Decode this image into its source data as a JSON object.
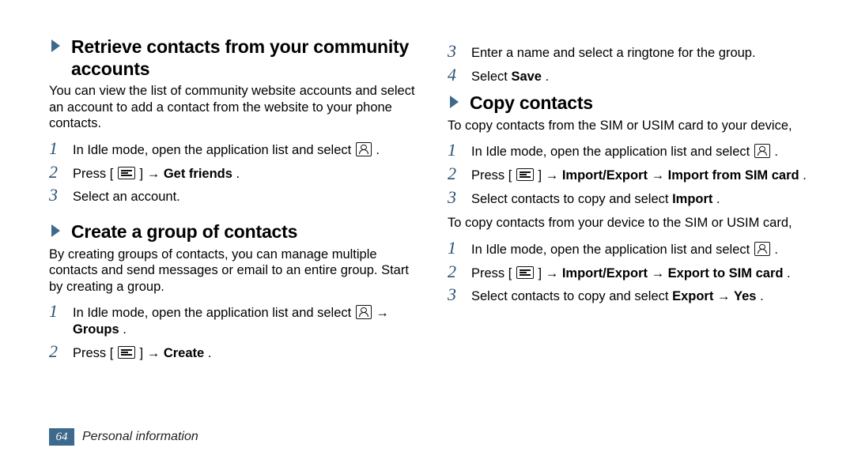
{
  "left": {
    "sec1": {
      "title": "Retrieve contacts from your community accounts",
      "para": "You can view the list of community website accounts and select an account to add a contact from the website to your phone contacts.",
      "steps": {
        "s1_a": "In Idle mode, open the application list and select ",
        "s1_b": ".",
        "s2_a": "Press [",
        "s2_b": "] → ",
        "s2_c": "Get friends",
        "s2_d": ".",
        "s3": "Select an account."
      }
    },
    "sec2": {
      "title": "Create a group of contacts",
      "para": "By creating groups of contacts, you can manage multiple contacts and send messages or email to an entire group. Start by creating a group.",
      "steps": {
        "s1_a": "In Idle mode, open the application list and select ",
        "s1_b": " → ",
        "s1_c": "Groups",
        "s1_d": ".",
        "s2_a": "Press [",
        "s2_b": "] → ",
        "s2_c": "Create",
        "s2_d": "."
      }
    }
  },
  "right": {
    "steps_top": {
      "s3": "Enter a name and select a ringtone for the group.",
      "s4_a": "Select ",
      "s4_b": "Save",
      "s4_c": "."
    },
    "sec": {
      "title": "Copy contacts",
      "para1": "To copy contacts from the SIM or USIM card to your device,",
      "stepsA": {
        "s1_a": "In Idle mode, open the application list and select ",
        "s1_b": ".",
        "s2_a": "Press [",
        "s2_b": "] → ",
        "s2_c": "Import/Export",
        "s2_d": " → ",
        "s2_e": "Import from SIM card",
        "s2_f": ".",
        "s3_a": "Select contacts to copy and select ",
        "s3_b": "Import",
        "s3_c": "."
      },
      "para2": "To copy contacts from your device to the SIM or USIM card,",
      "stepsB": {
        "s1_a": "In Idle mode, open the application list and select ",
        "s1_b": ".",
        "s2_a": "Press [",
        "s2_b": "] → ",
        "s2_c": "Import/Export",
        "s2_d": " → ",
        "s2_e": "Export to SIM card",
        "s2_f": ".",
        "s3_a": "Select contacts to copy and select ",
        "s3_b": "Export",
        "s3_c": " → ",
        "s3_d": "Yes",
        "s3_e": "."
      }
    }
  },
  "nums": {
    "n1": "1",
    "n2": "2",
    "n3": "3",
    "n4": "4"
  },
  "footer": {
    "page": "64",
    "label": "Personal information"
  },
  "colors": {
    "accent": "#3d6a8c"
  }
}
